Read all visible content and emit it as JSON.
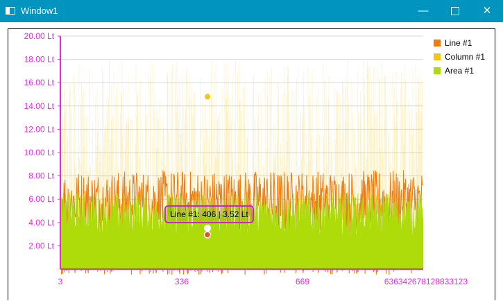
{
  "window": {
    "title": "Window1",
    "minimize_glyph": "—",
    "close_glyph": "✕"
  },
  "chart_data": {
    "type": "area",
    "y_ticks": [
      "2.00 Lt",
      "4.00 Lt",
      "6.00 Lt",
      "8.00 Lt",
      "10.00 Lt",
      "12.00 Lt",
      "14.00 Lt",
      "16.00 Lt",
      "18.00 Lt",
      "20.00 Lt"
    ],
    "x_ticks": [
      "3",
      "336",
      "669",
      "636342678128833123"
    ],
    "ylim": [
      0,
      20
    ],
    "grid": true,
    "legend_position": "top-right",
    "series": [
      {
        "name": "Line #1",
        "type": "line",
        "color": "#f07a10",
        "approx_range": [
          3,
          8.5
        ]
      },
      {
        "name": "Column #1",
        "type": "column",
        "color": "#f2c51a",
        "approx_range": [
          0,
          18
        ],
        "highlight_point": {
          "x": 406,
          "y": 14.8
        }
      },
      {
        "name": "Area #1",
        "type": "area",
        "color": "#aedc0a",
        "approx_range": [
          0,
          7
        ]
      }
    ],
    "tooltip": "Line #1: 406 | 3.52 Lt",
    "axis_color": "#e629e6",
    "grid_color": "#d8d8d8"
  }
}
